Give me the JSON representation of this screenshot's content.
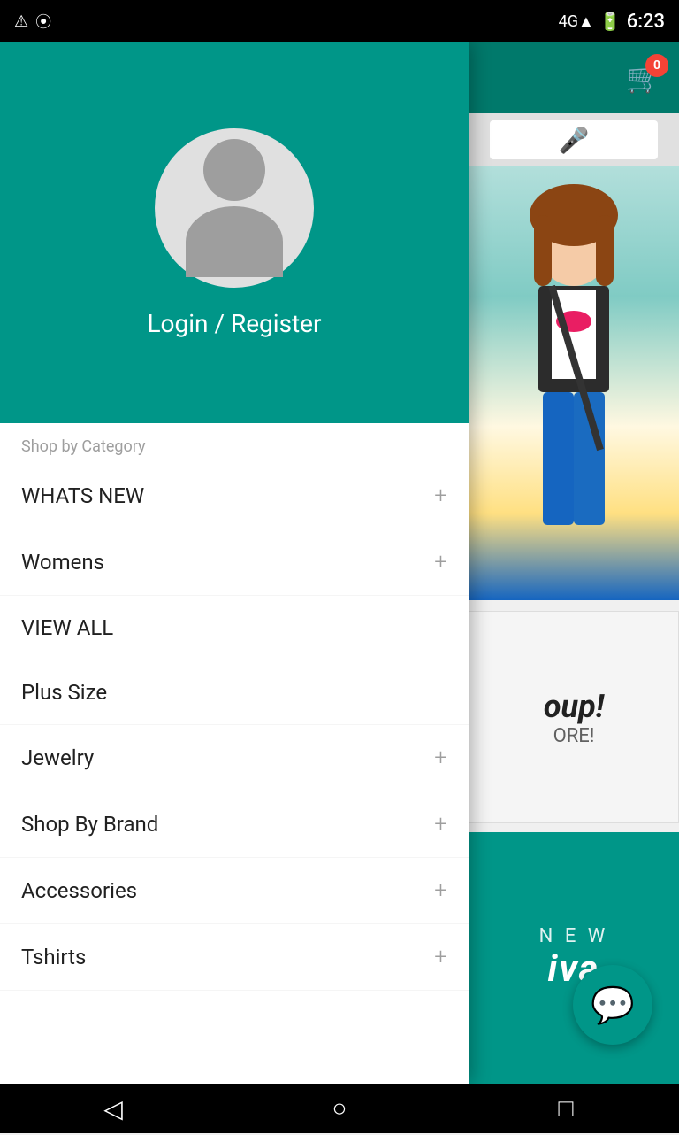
{
  "statusBar": {
    "time": "6:23",
    "icons": [
      "warning-icon",
      "data-icon"
    ],
    "signal": "4G",
    "battery": "100"
  },
  "cart": {
    "badge": "0"
  },
  "drawer": {
    "loginText": "Login / Register",
    "sectionLabel": "Shop by Category",
    "menuItems": [
      {
        "label": "WHATS NEW",
        "hasExpand": true
      },
      {
        "label": "Womens",
        "hasExpand": true
      },
      {
        "label": "VIEW ALL",
        "hasExpand": false
      },
      {
        "label": "Plus Size",
        "hasExpand": false
      },
      {
        "label": "Jewelry",
        "hasExpand": true
      },
      {
        "label": "Shop By Brand",
        "hasExpand": true
      },
      {
        "label": "Accessories",
        "hasExpand": true
      },
      {
        "label": "Tshirts",
        "hasExpand": true
      }
    ]
  },
  "banner": {
    "mainText": "oup!",
    "subText": "ORE!"
  },
  "banner2": {
    "text": "iva"
  },
  "nav": {
    "back": "◁",
    "home": "○",
    "recent": "□"
  }
}
